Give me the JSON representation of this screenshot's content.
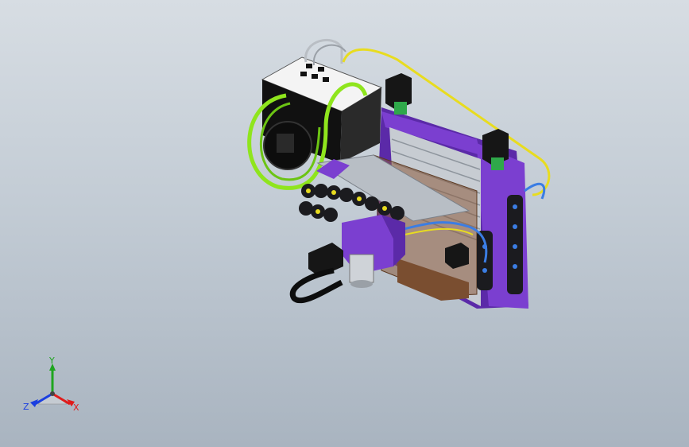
{
  "viewport": {
    "background_top": "#d7dde3",
    "background_bottom": "#a9b4c0"
  },
  "model": {
    "description_icon": "cnc-gantry-assembly-icon",
    "colors": {
      "frame_purple": "#7b3fd0",
      "frame_purple_dark": "#4f1f96",
      "rail_silver": "#c7ccd2",
      "rail_shadow": "#8e959d",
      "drag_chain": "#1b1b1f",
      "motor_black": "#161616",
      "pcb_green": "#2fa84a",
      "cable_yellow": "#e8dc1f",
      "cable_green": "#8fe51d",
      "cable_blue": "#3b7de3",
      "brown_panel": "#8a5a3a",
      "box_white": "#f4f4f4"
    }
  },
  "triad": {
    "x_label": "X",
    "y_label": "Y",
    "z_label": "Z",
    "x_color": "#e01b1b",
    "y_color": "#1fa51f",
    "z_color": "#1b3fe0"
  }
}
